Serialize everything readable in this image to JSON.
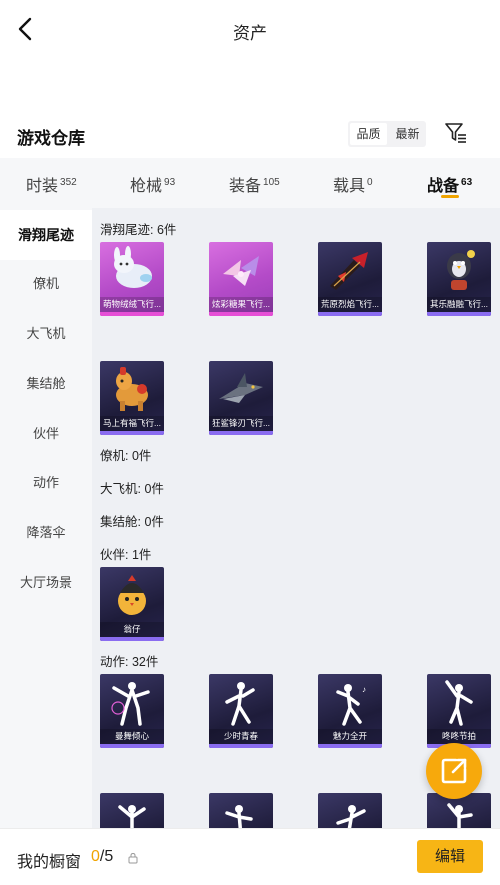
{
  "header": {
    "title": "资产"
  },
  "warehouse": {
    "title": "游戏仓库",
    "sort_options": [
      "品质",
      "最新"
    ]
  },
  "tabs": [
    {
      "label": "时装",
      "count": "352"
    },
    {
      "label": "枪械",
      "count": "93"
    },
    {
      "label": "装备",
      "count": "105"
    },
    {
      "label": "载具",
      "count": "0"
    },
    {
      "label": "战备",
      "count": "63"
    }
  ],
  "sidebar": [
    "滑翔尾迹",
    "僚机",
    "大飞机",
    "集结舱",
    "伙伴",
    "动作",
    "降落伞",
    "大厅场景"
  ],
  "sections": {
    "trail": "滑翔尾迹: 6件",
    "wingman": "僚机: 0件",
    "bigplane": "大飞机: 0件",
    "pod": "集结舱: 0件",
    "partner": "伙伴: 1件",
    "emote": "动作: 32件"
  },
  "items": {
    "trail": [
      "萌物绒绒飞行...",
      "炫彩糖果飞行...",
      "荒原烈焰飞行...",
      "其乐融融飞行...",
      "马上有福飞行...",
      "狂鲨锋刃飞行..."
    ],
    "partner": [
      "翁仔"
    ],
    "emote": [
      "曼舞倾心",
      "少时青春",
      "魅力全开",
      "咚咚节拍"
    ]
  },
  "footer": {
    "showcase_label": "我的橱窗",
    "showcase_current": "0",
    "showcase_total": "/5",
    "edit_label": "编辑"
  },
  "colors": {
    "accent": "#f7b515",
    "fab": "#f7a90c"
  },
  "icons": [
    "back-arrow-icon",
    "filter-icon",
    "share-icon",
    "lock-icon"
  ]
}
